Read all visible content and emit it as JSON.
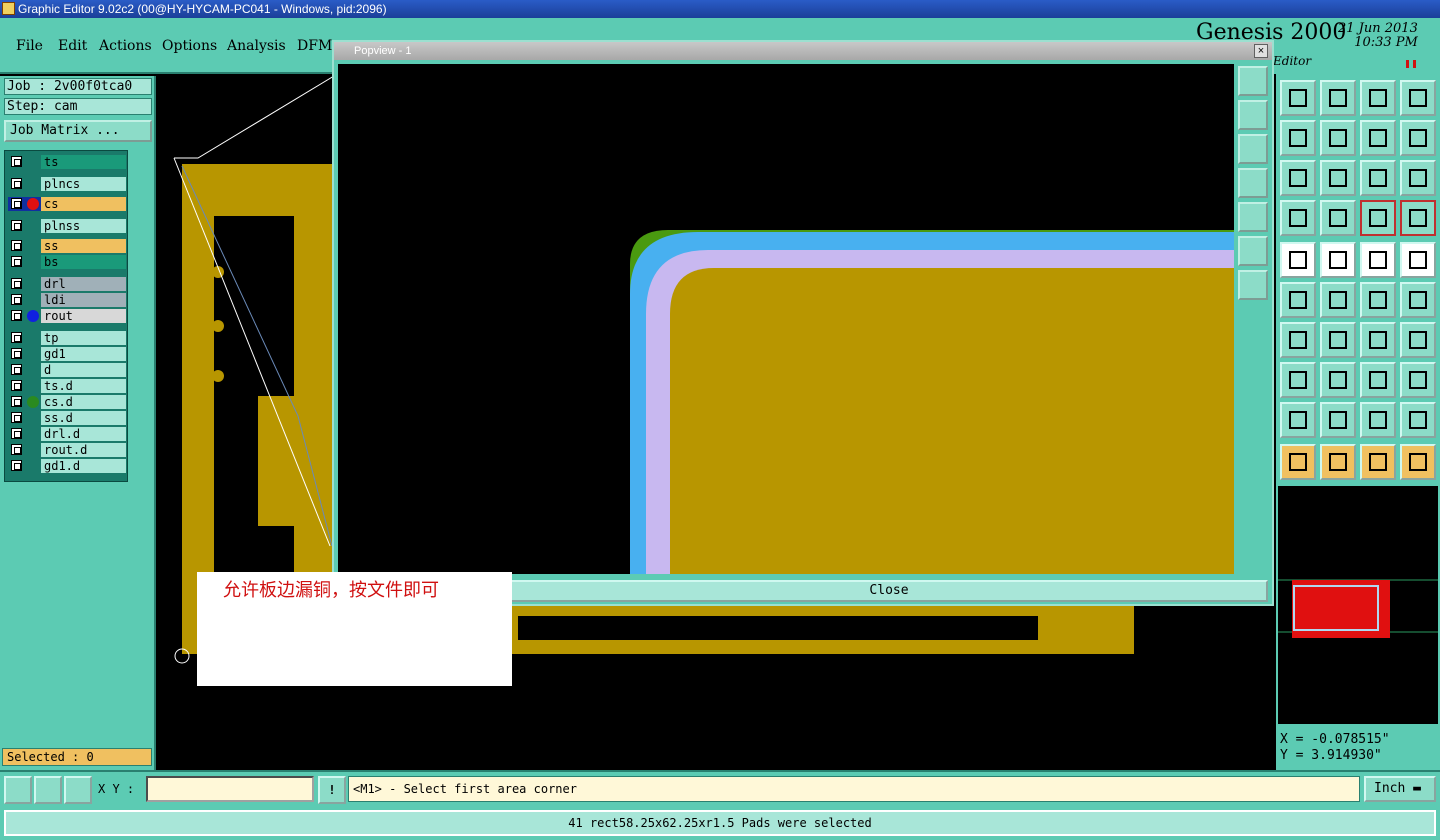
{
  "window_title": "Graphic Editor 9.02c2 (00@HY-HYCAM-PC041 - Windows, pid:2096)",
  "menu": [
    "File",
    "Edit",
    "Actions",
    "Options",
    "Analysis",
    "DFM"
  ],
  "header": {
    "logo": "Genesis 2000",
    "date": "21 Jun 2013",
    "time": "10:33 PM",
    "editor_label": "Editor"
  },
  "job": {
    "job_label": "Job : 2v00f0tca0",
    "step_label": "Step: cam",
    "matrix_button": "Job Matrix ..."
  },
  "layers": [
    {
      "name": "ts",
      "color": "#1a9a7a",
      "dot": ""
    },
    {
      "name": "plncs",
      "color": "#a8e6d8",
      "dot": ""
    },
    {
      "name": "cs",
      "color": "#f0c060",
      "dot": "#e01010",
      "selected": true
    },
    {
      "name": "plnss",
      "color": "#a8e6d8",
      "dot": ""
    },
    {
      "name": "ss",
      "color": "#f0c060",
      "dot": ""
    },
    {
      "name": "bs",
      "color": "#1a9a7a",
      "dot": ""
    },
    {
      "name": "drl",
      "color": "#a0b0b8",
      "dot": ""
    },
    {
      "name": "ldi",
      "color": "#a0b0b8",
      "dot": ""
    },
    {
      "name": "rout",
      "color": "#d8d8d8",
      "dot": "#1020e0"
    },
    {
      "name": "tp",
      "color": "#a8e6d8",
      "dot": ""
    },
    {
      "name": "gd1",
      "color": "#a8e6d8",
      "dot": ""
    },
    {
      "name": "d",
      "color": "#a8e6d8",
      "dot": ""
    },
    {
      "name": "ts.d",
      "color": "#a8e6d8",
      "dot": ""
    },
    {
      "name": "cs.d",
      "color": "#a8e6d8",
      "dot": "#2a8a20"
    },
    {
      "name": "ss.d",
      "color": "#a8e6d8",
      "dot": ""
    },
    {
      "name": "drl.d",
      "color": "#a8e6d8",
      "dot": ""
    },
    {
      "name": "rout.d",
      "color": "#a8e6d8",
      "dot": ""
    },
    {
      "name": "gd1.d",
      "color": "#a8e6d8",
      "dot": ""
    }
  ],
  "selected_label": "Selected : 0",
  "popup": {
    "title": "Popview - 1",
    "close_label": "Close"
  },
  "note_text": "允许板边漏铜，按文件即可",
  "coords": {
    "x": "X = -0.078515\"",
    "y": "Y = 3.914930\""
  },
  "bottom": {
    "xy_label": "X Y :",
    "message": "<M1> - Select first area corner",
    "unit": "Inch"
  },
  "status_text": "41 rect58.25x62.25xr1.5 Pads were selected",
  "toolbar_icons": [
    "zoom-home-icon",
    "zoom-out-icon",
    "home-icon",
    "split-view-icon",
    "pan-left-icon",
    "pan-right-icon",
    "undo-view-icon",
    "snake-icon",
    "fit-icon",
    "zoom-fit-icon",
    "scale-1-2-icon",
    "help-icon",
    "tools-icon",
    "grid-icon",
    "layers-red-icon",
    "layers-red2-icon",
    "drill-icon",
    "line-icon",
    "ruler-icon",
    "pad-icon",
    "connect-icon",
    "cross-icon",
    "move-icon",
    "snap-icon",
    "angle-icon",
    "diagonal-icon",
    "rotate-icon",
    "mirror-icon",
    "pad-select-icon",
    "dash-icon",
    "measure-icon",
    "copy-icon",
    "tri-icon",
    "tri2-icon",
    "tri3-icon",
    "tri4-icon",
    "select-icon",
    "select2-icon",
    "select3-icon",
    "select4-icon"
  ]
}
